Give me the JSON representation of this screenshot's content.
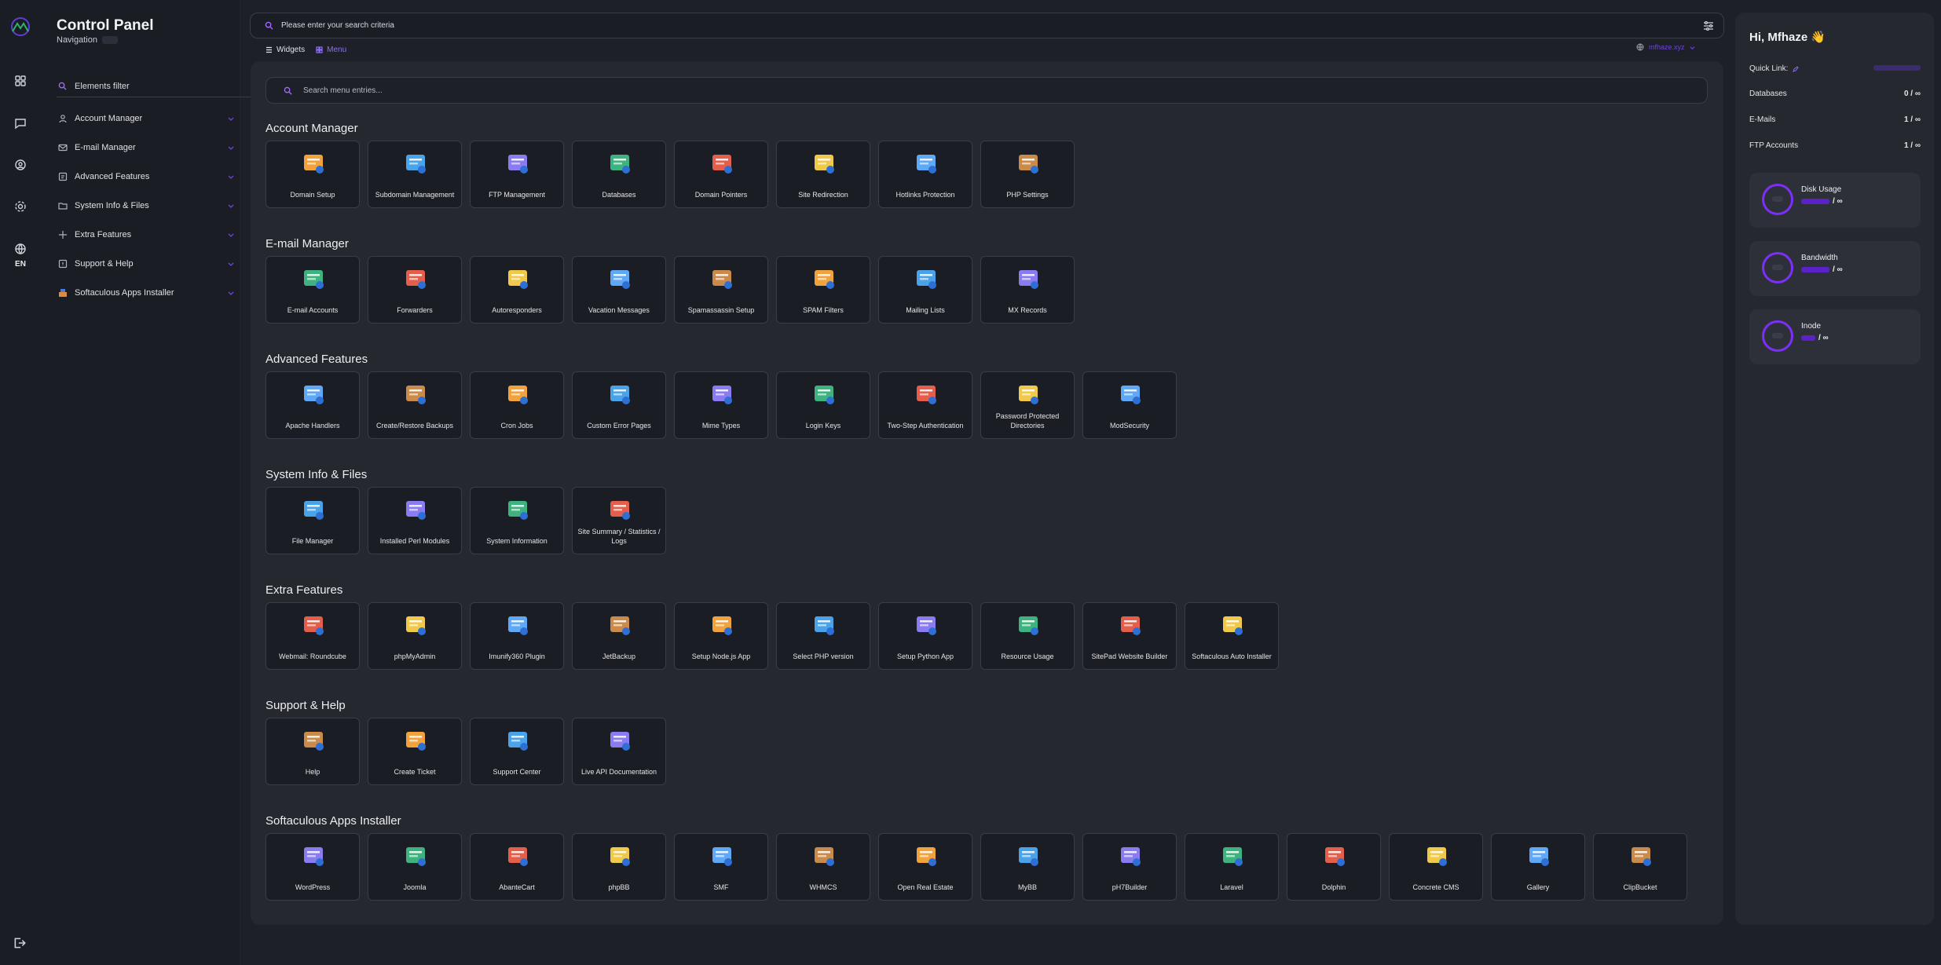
{
  "sidebar": {
    "title": "Control Panel",
    "subtitle": "Navigation",
    "filter_label": "Elements filter",
    "lang": "EN",
    "items": [
      {
        "label": "Account Manager",
        "icon": "user-icon"
      },
      {
        "label": "E-mail Manager",
        "icon": "mail-icon"
      },
      {
        "label": "Advanced Features",
        "icon": "features-icon"
      },
      {
        "label": "System Info & Files",
        "icon": "files-icon"
      },
      {
        "label": "Extra Features",
        "icon": "plus-icon"
      },
      {
        "label": "Support & Help",
        "icon": "help-icon"
      },
      {
        "label": "Softaculous Apps Installer",
        "icon": "softaculous-icon"
      }
    ]
  },
  "header": {
    "search_placeholder": "Please enter your search criteria",
    "tab_widgets": "Widgets",
    "tab_menu": "Menu",
    "domain": "mfhaze.xyz"
  },
  "main": {
    "menu_search_placeholder": "Search menu entries...",
    "sections": [
      {
        "title": "Account Manager",
        "tiles": [
          {
            "label": "Domain Setup",
            "icon": "www-icon"
          },
          {
            "label": "Subdomain Management",
            "icon": "subdomain-icon"
          },
          {
            "label": "FTP Management",
            "icon": "ftp-icon"
          },
          {
            "label": "Databases",
            "icon": "sql-icon"
          },
          {
            "label": "Domain Pointers",
            "icon": "monitor-icon"
          },
          {
            "label": "Site Redirection",
            "icon": "signpost-icon"
          },
          {
            "label": "Hotlinks Protection",
            "icon": "lock-icon"
          },
          {
            "label": "PHP Settings",
            "icon": "php-icon"
          }
        ]
      },
      {
        "title": "E-mail Manager",
        "tiles": [
          {
            "label": "E-mail Accounts",
            "icon": "envelope-icon"
          },
          {
            "label": "Forwarders",
            "icon": "forward-icon"
          },
          {
            "label": "Autoresponders",
            "icon": "autoresponder-icon"
          },
          {
            "label": "Vacation Messages",
            "icon": "vacation-icon"
          },
          {
            "label": "Spamassassin Setup",
            "icon": "spam-envelope-icon"
          },
          {
            "label": "SPAM Filters",
            "icon": "filter-envelope-icon"
          },
          {
            "label": "Mailing Lists",
            "icon": "mailing-list-icon"
          },
          {
            "label": "MX Records",
            "icon": "mx-icon"
          }
        ]
      },
      {
        "title": "Advanced Features",
        "tiles": [
          {
            "label": "Apache Handlers",
            "icon": "apache-icon"
          },
          {
            "label": "Create/Restore Backups",
            "icon": "backup-icon"
          },
          {
            "label": "Cron Jobs",
            "icon": "cron-icon"
          },
          {
            "label": "Custom Error Pages",
            "icon": "error-page-icon"
          },
          {
            "label": "Mime Types",
            "icon": "mime-icon"
          },
          {
            "label": "Login Keys",
            "icon": "key-icon"
          },
          {
            "label": "Two-Step Authentication",
            "icon": "two-step-icon"
          },
          {
            "label": "Password Protected Directories",
            "icon": "protected-folder-icon"
          },
          {
            "label": "ModSecurity",
            "icon": "modsecurity-icon"
          }
        ]
      },
      {
        "title": "System Info & Files",
        "tiles": [
          {
            "label": "File Manager",
            "icon": "folder-icon"
          },
          {
            "label": "Installed Perl Modules",
            "icon": "perl-icon"
          },
          {
            "label": "System Information",
            "icon": "sysinfo-icon"
          },
          {
            "label": "Site Summary / Statistics / Logs",
            "icon": "stats-icon"
          }
        ]
      },
      {
        "title": "Extra Features",
        "tiles": [
          {
            "label": "Webmail: Roundcube",
            "icon": "roundcube-icon"
          },
          {
            "label": "phpMyAdmin",
            "icon": "phpmyadmin-icon"
          },
          {
            "label": "Imunify360 Plugin",
            "icon": "imunify-icon"
          },
          {
            "label": "JetBackup",
            "icon": "jetbackup-icon"
          },
          {
            "label": "Setup Node.js App",
            "icon": "nodejs-icon"
          },
          {
            "label": "Select PHP version",
            "icon": "php-version-icon"
          },
          {
            "label": "Setup Python App",
            "icon": "python-icon"
          },
          {
            "label": "Resource Usage",
            "icon": "resource-icon"
          },
          {
            "label": "SitePad Website Builder",
            "icon": "sitepad-icon"
          },
          {
            "label": "Softaculous Auto Installer",
            "icon": "softaculous-box-icon"
          }
        ]
      },
      {
        "title": "Support & Help",
        "tiles": [
          {
            "label": "Help",
            "icon": "support-agent-icon"
          },
          {
            "label": "Create Ticket",
            "icon": "ticket-icon"
          },
          {
            "label": "Support Center",
            "icon": "support-center-icon"
          },
          {
            "label": "Live API Documentation",
            "icon": "api-icon"
          }
        ]
      },
      {
        "title": "Softaculous Apps Installer",
        "tiles": [
          {
            "label": "WordPress",
            "icon": "wordpress-icon"
          },
          {
            "label": "Joomla",
            "icon": "joomla-icon"
          },
          {
            "label": "AbanteCart",
            "icon": "abantecart-icon"
          },
          {
            "label": "phpBB",
            "icon": "phpbb-icon"
          },
          {
            "label": "SMF",
            "icon": "smf-icon"
          },
          {
            "label": "WHMCS",
            "icon": "whmcs-icon"
          },
          {
            "label": "Open Real Estate",
            "icon": "real-estate-icon"
          },
          {
            "label": "MyBB",
            "icon": "mybb-icon"
          },
          {
            "label": "pH7Builder",
            "icon": "ph7-icon"
          },
          {
            "label": "Laravel",
            "icon": "laravel-icon"
          },
          {
            "label": "Dolphin",
            "icon": "dolphin-icon"
          },
          {
            "label": "Concrete CMS",
            "icon": "concrete-icon"
          },
          {
            "label": "Gallery",
            "icon": "gallery-icon"
          },
          {
            "label": "ClipBucket",
            "icon": "clipbucket-icon"
          }
        ]
      }
    ]
  },
  "right": {
    "greeting": "Hi, Mfhaze 👋",
    "quick_link": "Quick Link:",
    "stats": [
      {
        "label": "Databases",
        "value": "0 / ∞"
      },
      {
        "label": "E-Mails",
        "value": "1 / ∞"
      },
      {
        "label": "FTP Accounts",
        "value": "1 / ∞"
      }
    ],
    "usage": [
      {
        "label": "Disk Usage",
        "limit": "/ ∞"
      },
      {
        "label": "Bandwidth",
        "limit": "/ ∞"
      },
      {
        "label": "Inode",
        "limit": "/ ∞"
      }
    ]
  },
  "colors": {
    "accent": "#8f6cff",
    "bg": "#1e2028",
    "panel": "#262830",
    "tile": "#1b1d24"
  }
}
